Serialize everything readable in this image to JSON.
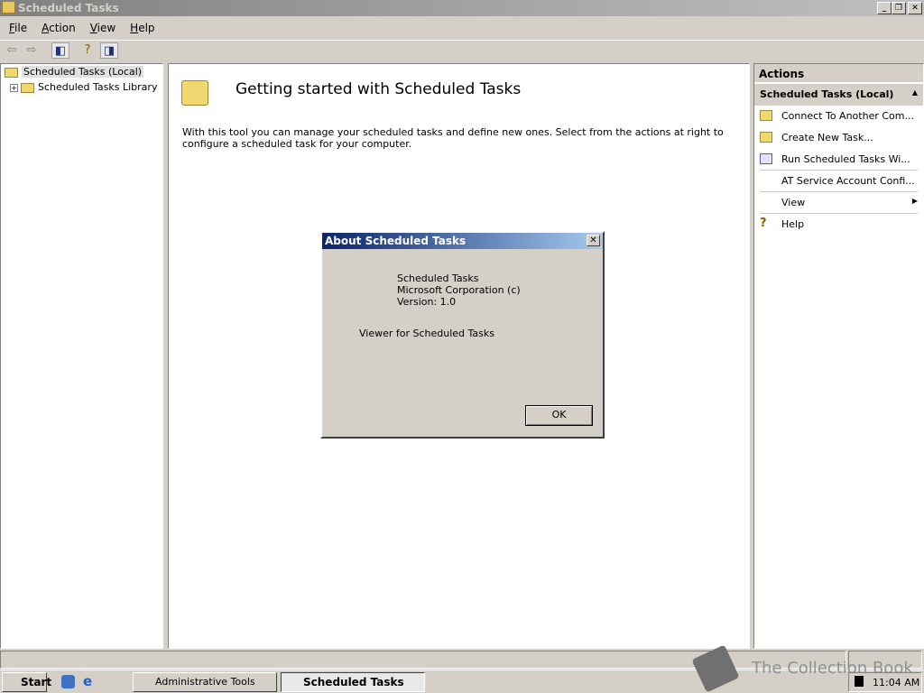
{
  "window": {
    "title": "Scheduled Tasks"
  },
  "menu": [
    "File",
    "Action",
    "View",
    "Help"
  ],
  "tree": {
    "root": "Scheduled Tasks (Local)",
    "child": "Scheduled Tasks Library"
  },
  "main": {
    "heading": "Getting started with Scheduled Tasks",
    "body": "With this tool you can manage your scheduled tasks and define new ones.  Select from the actions at right to configure a scheduled task for your computer."
  },
  "actions": {
    "header": "Actions",
    "section": "Scheduled Tasks (Local)",
    "items": [
      "Connect To Another Com...",
      "Create New Task...",
      "Run Scheduled Tasks Wi...",
      "AT Service Account Confi...",
      "View",
      "Help"
    ]
  },
  "dialog": {
    "title": "About Scheduled Tasks",
    "product": "Scheduled Tasks",
    "company": "Microsoft Corporation (c)",
    "version": "Version: 1.0",
    "description": "Viewer for Scheduled Tasks",
    "ok": "OK"
  },
  "taskbar": {
    "start": "Start",
    "tasks": [
      "Administrative Tools",
      "Scheduled Tasks"
    ],
    "clock": "11:04 AM"
  },
  "watermark": "The Collection Book"
}
